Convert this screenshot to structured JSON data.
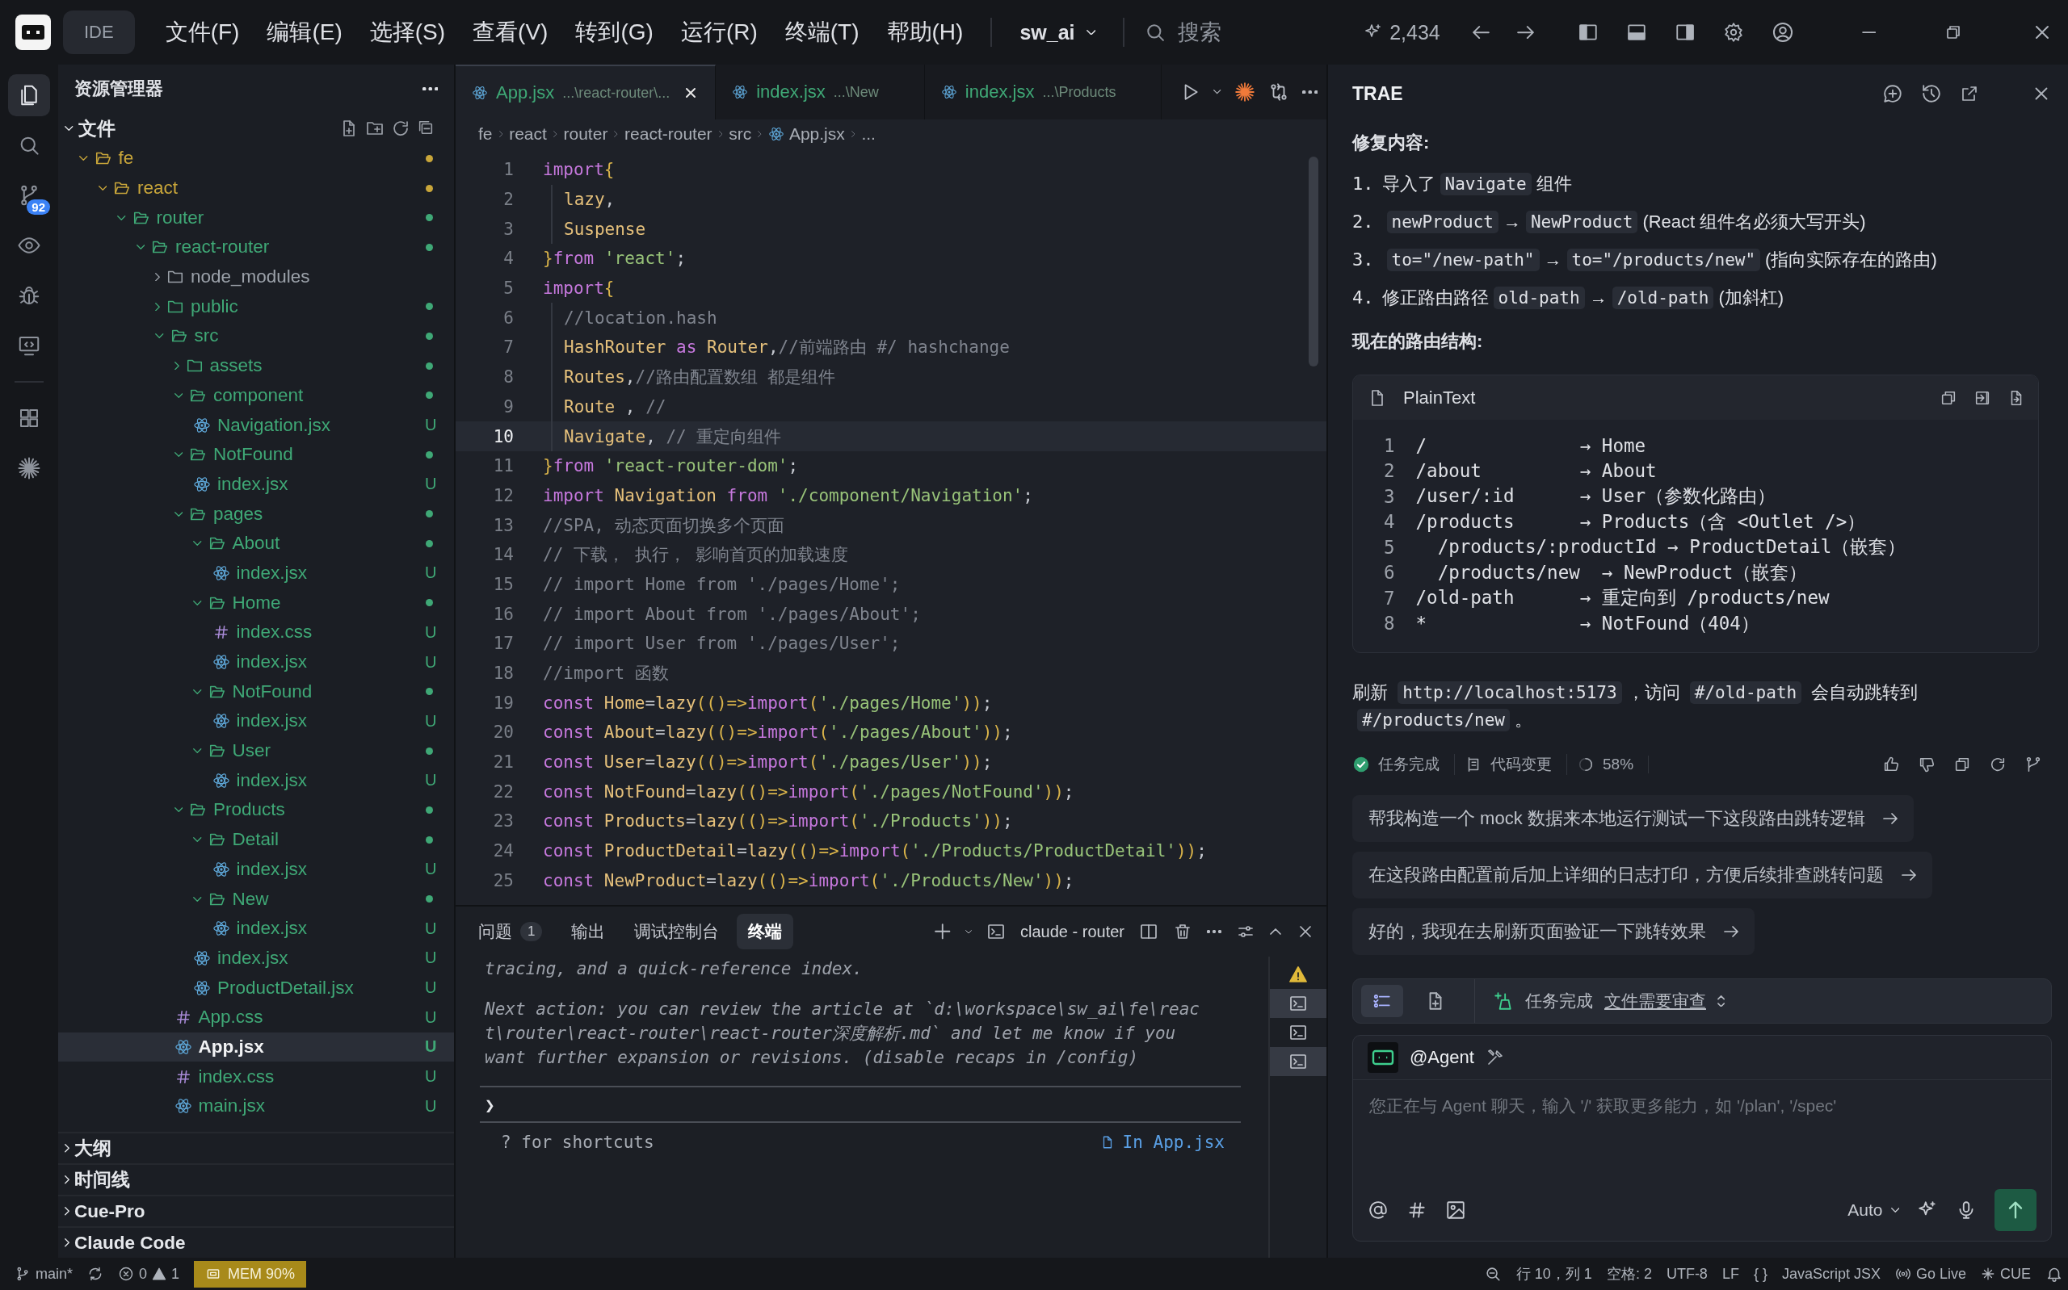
{
  "title_bar": {
    "app_label": "IDE",
    "menus": [
      "文件(F)",
      "编辑(E)",
      "选择(S)",
      "查看(V)",
      "转到(G)",
      "运行(R)",
      "终端(T)",
      "帮助(H)"
    ],
    "project": "sw_ai",
    "search_placeholder": "搜索",
    "credits": "2,434"
  },
  "activity_bar": {
    "items": [
      {
        "kind": "files",
        "selected": true
      },
      {
        "kind": "search",
        "selected": false
      },
      {
        "kind": "source-control",
        "selected": false,
        "badge": "92"
      },
      {
        "kind": "preview",
        "selected": false
      },
      {
        "kind": "debug",
        "selected": false
      },
      {
        "kind": "remote",
        "selected": false
      },
      {
        "kind": "extensions",
        "selected": false
      },
      {
        "kind": "agent",
        "selected": false
      }
    ]
  },
  "explorer": {
    "title": "资源管理器",
    "section": {
      "label": "文件",
      "expanded": true
    },
    "tree": [
      {
        "name": "fe",
        "kind": "folder",
        "expanded": true,
        "selected": false,
        "color": "#c9a63a",
        "dot": true,
        "children": [
          {
            "name": "react",
            "kind": "folder",
            "expanded": true,
            "selected": false,
            "color": "#c9a63a",
            "dot": true,
            "children": [
              {
                "name": "router",
                "kind": "folder",
                "expanded": true,
                "selected": false,
                "color": "#3fa876",
                "dot": true,
                "children": [
                  {
                    "name": "react-router",
                    "kind": "folder",
                    "expanded": true,
                    "selected": false,
                    "color": "#3fa876",
                    "dot": true,
                    "children": [
                      {
                        "name": "node_modules",
                        "kind": "folder",
                        "expanded": false,
                        "selected": false,
                        "color": "#9ba1a9",
                        "dot": false
                      },
                      {
                        "name": "public",
                        "kind": "folder",
                        "expanded": false,
                        "selected": false,
                        "color": "#3fa876",
                        "dot": true
                      },
                      {
                        "name": "src",
                        "kind": "folder",
                        "expanded": true,
                        "selected": false,
                        "color": "#3fa876",
                        "dot": true,
                        "children": [
                          {
                            "name": "assets",
                            "kind": "folder",
                            "expanded": false,
                            "selected": false,
                            "color": "#3fa876",
                            "dot": true
                          },
                          {
                            "name": "component",
                            "kind": "folder",
                            "expanded": true,
                            "selected": false,
                            "color": "#3fa876",
                            "dot": true,
                            "children": [
                              {
                                "name": "Navigation.jsx",
                                "kind": "jsx",
                                "selected": false,
                                "color": "#3fa876",
                                "badge": "U"
                              }
                            ]
                          },
                          {
                            "name": "NotFound",
                            "kind": "folder",
                            "expanded": true,
                            "selected": false,
                            "color": "#3fa876",
                            "dot": true,
                            "children": [
                              {
                                "name": "index.jsx",
                                "kind": "jsx",
                                "selected": false,
                                "color": "#3fa876",
                                "badge": "U"
                              }
                            ]
                          },
                          {
                            "name": "pages",
                            "kind": "folder",
                            "expanded": true,
                            "selected": false,
                            "color": "#3fa876",
                            "dot": true,
                            "children": [
                              {
                                "name": "About",
                                "kind": "folder",
                                "expanded": true,
                                "selected": false,
                                "color": "#3fa876",
                                "dot": true,
                                "children": [
                                  {
                                    "name": "index.jsx",
                                    "kind": "jsx",
                                    "selected": false,
                                    "color": "#3fa876",
                                    "badge": "U"
                                  }
                                ]
                              },
                              {
                                "name": "Home",
                                "kind": "folder",
                                "expanded": true,
                                "selected": false,
                                "color": "#3fa876",
                                "dot": true,
                                "children": [
                                  {
                                    "name": "index.css",
                                    "kind": "css",
                                    "selected": false,
                                    "color": "#3fa876",
                                    "badge": "U"
                                  },
                                  {
                                    "name": "index.jsx",
                                    "kind": "jsx",
                                    "selected": false,
                                    "color": "#3fa876",
                                    "badge": "U"
                                  }
                                ]
                              },
                              {
                                "name": "NotFound",
                                "kind": "folder",
                                "expanded": true,
                                "selected": false,
                                "color": "#3fa876",
                                "dot": true,
                                "children": [
                                  {
                                    "name": "index.jsx",
                                    "kind": "jsx",
                                    "selected": false,
                                    "color": "#3fa876",
                                    "badge": "U"
                                  }
                                ]
                              },
                              {
                                "name": "User",
                                "kind": "folder",
                                "expanded": true,
                                "selected": false,
                                "color": "#3fa876",
                                "dot": true,
                                "children": [
                                  {
                                    "name": "index.jsx",
                                    "kind": "jsx",
                                    "selected": false,
                                    "color": "#3fa876",
                                    "badge": "U"
                                  }
                                ]
                              }
                            ]
                          },
                          {
                            "name": "Products",
                            "kind": "folder",
                            "expanded": true,
                            "selected": false,
                            "color": "#3fa876",
                            "dot": true,
                            "children": [
                              {
                                "name": "Detail",
                                "kind": "folder",
                                "expanded": true,
                                "selected": false,
                                "color": "#3fa876",
                                "dot": true,
                                "children": [
                                  {
                                    "name": "index.jsx",
                                    "kind": "jsx",
                                    "selected": false,
                                    "color": "#3fa876",
                                    "badge": "U"
                                  }
                                ]
                              },
                              {
                                "name": "New",
                                "kind": "folder",
                                "expanded": true,
                                "selected": false,
                                "color": "#3fa876",
                                "dot": true,
                                "children": [
                                  {
                                    "name": "index.jsx",
                                    "kind": "jsx",
                                    "selected": false,
                                    "color": "#3fa876",
                                    "badge": "U"
                                  }
                                ]
                              },
                              {
                                "name": "index.jsx",
                                "kind": "jsx",
                                "selected": false,
                                "color": "#3fa876",
                                "badge": "U"
                              },
                              {
                                "name": "ProductDetail.jsx",
                                "kind": "jsx",
                                "selected": false,
                                "color": "#3fa876",
                                "badge": "U"
                              }
                            ]
                          },
                          {
                            "name": "App.css",
                            "kind": "css",
                            "selected": false,
                            "color": "#3fa876",
                            "badge": "U"
                          },
                          {
                            "name": "App.jsx",
                            "kind": "jsx",
                            "selected": true,
                            "color": "#3fa876",
                            "badge": "U"
                          },
                          {
                            "name": "index.css",
                            "kind": "css",
                            "selected": false,
                            "color": "#3fa876",
                            "badge": "U"
                          },
                          {
                            "name": "main.jsx",
                            "kind": "jsx",
                            "selected": false,
                            "color": "#3fa876",
                            "badge": "U"
                          }
                        ]
                      }
                    ]
                  }
                ]
              }
            ]
          }
        ]
      }
    ],
    "panels": [
      {
        "label": "大纲",
        "expanded": false
      },
      {
        "label": "时间线",
        "expanded": false
      },
      {
        "label": "Cue-Pro",
        "expanded": false
      },
      {
        "label": "Claude Code",
        "expanded": false
      }
    ]
  },
  "editor": {
    "tabs": [
      {
        "name": "App.jsx",
        "path": "...\\react-router\\...",
        "selected": true
      },
      {
        "name": "index.jsx",
        "path": "...\\New",
        "selected": false
      },
      {
        "name": "index.jsx",
        "path": "...\\Products",
        "selected": false
      }
    ],
    "breadcrumbs": [
      {
        "label": "fe",
        "kind": "folder"
      },
      {
        "label": "react",
        "kind": "folder"
      },
      {
        "label": "router",
        "kind": "folder"
      },
      {
        "label": "react-router",
        "kind": "folder"
      },
      {
        "label": "src",
        "kind": "folder"
      },
      {
        "label": "App.jsx",
        "kind": "jsx"
      },
      {
        "label": "...",
        "kind": "more"
      }
    ],
    "lines": [
      {
        "number": "1",
        "selected": false,
        "indent": false,
        "tokens": [
          {
            "kind": "kw",
            "text": "import"
          },
          {
            "kind": "br",
            "text": "{"
          }
        ]
      },
      {
        "number": "2",
        "selected": false,
        "indent": true,
        "tokens": [
          {
            "kind": "id",
            "text": "lazy"
          },
          {
            "kind": "p",
            "text": ","
          }
        ]
      },
      {
        "number": "3",
        "selected": false,
        "indent": true,
        "tokens": [
          {
            "kind": "id",
            "text": "Suspense"
          }
        ]
      },
      {
        "number": "4",
        "selected": false,
        "indent": false,
        "tokens": [
          {
            "kind": "br",
            "text": "}"
          },
          {
            "kind": "kw",
            "text": "from "
          },
          {
            "kind": "str",
            "text": "'react'"
          },
          {
            "kind": "p",
            "text": ";"
          }
        ]
      },
      {
        "number": "5",
        "selected": false,
        "indent": false,
        "tokens": [
          {
            "kind": "kw",
            "text": "import"
          },
          {
            "kind": "br",
            "text": "{"
          }
        ]
      },
      {
        "number": "6",
        "selected": false,
        "indent": true,
        "tokens": [
          {
            "kind": "com",
            "text": "//location.hash"
          }
        ]
      },
      {
        "number": "7",
        "selected": false,
        "indent": true,
        "tokens": [
          {
            "kind": "id",
            "text": "HashRouter "
          },
          {
            "kind": "kw",
            "text": "as "
          },
          {
            "kind": "id",
            "text": "Router"
          },
          {
            "kind": "p",
            "text": ","
          },
          {
            "kind": "com",
            "text": "//前端路由 #/ hashchange"
          }
        ]
      },
      {
        "number": "8",
        "selected": false,
        "indent": true,
        "tokens": [
          {
            "kind": "id",
            "text": "Routes"
          },
          {
            "kind": "p",
            "text": ","
          },
          {
            "kind": "com",
            "text": "//路由配置数组 都是组件"
          }
        ]
      },
      {
        "number": "9",
        "selected": false,
        "indent": true,
        "tokens": [
          {
            "kind": "id",
            "text": "Route "
          },
          {
            "kind": "p",
            "text": ", "
          },
          {
            "kind": "com",
            "text": "//"
          }
        ]
      },
      {
        "number": "10",
        "selected": true,
        "indent": true,
        "tokens": [
          {
            "kind": "id",
            "text": "Navigate"
          },
          {
            "kind": "p",
            "text": ", "
          },
          {
            "kind": "com",
            "text": "// 重定向组件"
          }
        ]
      },
      {
        "number": "11",
        "selected": false,
        "indent": false,
        "tokens": [
          {
            "kind": "br",
            "text": "}"
          },
          {
            "kind": "kw",
            "text": "from "
          },
          {
            "kind": "str",
            "text": "'react-router-dom'"
          },
          {
            "kind": "p",
            "text": ";"
          }
        ]
      },
      {
        "number": "12",
        "selected": false,
        "indent": false,
        "tokens": [
          {
            "kind": "kw",
            "text": "import "
          },
          {
            "kind": "id",
            "text": "Navigation "
          },
          {
            "kind": "kw",
            "text": "from "
          },
          {
            "kind": "str",
            "text": "'./component/Navigation'"
          },
          {
            "kind": "p",
            "text": ";"
          }
        ]
      },
      {
        "number": "13",
        "selected": false,
        "indent": false,
        "tokens": [
          {
            "kind": "com",
            "text": "//SPA, 动态页面切换多个页面"
          }
        ]
      },
      {
        "number": "14",
        "selected": false,
        "indent": false,
        "tokens": [
          {
            "kind": "com",
            "text": "// 下载， 执行， 影响首页的加载速度"
          }
        ]
      },
      {
        "number": "15",
        "selected": false,
        "indent": false,
        "tokens": [
          {
            "kind": "com",
            "text": "// import Home from './pages/Home';"
          }
        ]
      },
      {
        "number": "16",
        "selected": false,
        "indent": false,
        "tokens": [
          {
            "kind": "com",
            "text": "// import About from './pages/About';"
          }
        ]
      },
      {
        "number": "17",
        "selected": false,
        "indent": false,
        "tokens": [
          {
            "kind": "com",
            "text": "// import User from './pages/User';"
          }
        ]
      },
      {
        "number": "18",
        "selected": false,
        "indent": false,
        "tokens": [
          {
            "kind": "com",
            "text": "//import 函数"
          }
        ]
      },
      {
        "number": "19",
        "selected": false,
        "indent": false,
        "tokens": [
          {
            "kind": "kw",
            "text": "const "
          },
          {
            "kind": "id",
            "text": "Home"
          },
          {
            "kind": "p",
            "text": "="
          },
          {
            "kind": "id",
            "text": "lazy"
          },
          {
            "kind": "br",
            "text": "(()=>"
          },
          {
            "kind": "kw",
            "text": "import"
          },
          {
            "kind": "br",
            "text": "("
          },
          {
            "kind": "str",
            "text": "'./pages/Home'"
          },
          {
            "kind": "br",
            "text": "))"
          },
          {
            "kind": "p",
            "text": ";"
          }
        ]
      },
      {
        "number": "20",
        "selected": false,
        "indent": false,
        "tokens": [
          {
            "kind": "kw",
            "text": "const "
          },
          {
            "kind": "id",
            "text": "About"
          },
          {
            "kind": "p",
            "text": "="
          },
          {
            "kind": "id",
            "text": "lazy"
          },
          {
            "kind": "br",
            "text": "(()=>"
          },
          {
            "kind": "kw",
            "text": "import"
          },
          {
            "kind": "br",
            "text": "("
          },
          {
            "kind": "str",
            "text": "'./pages/About'"
          },
          {
            "kind": "br",
            "text": "))"
          },
          {
            "kind": "p",
            "text": ";"
          }
        ]
      },
      {
        "number": "21",
        "selected": false,
        "indent": false,
        "tokens": [
          {
            "kind": "kw",
            "text": "const "
          },
          {
            "kind": "id",
            "text": "User"
          },
          {
            "kind": "p",
            "text": "="
          },
          {
            "kind": "id",
            "text": "lazy"
          },
          {
            "kind": "br",
            "text": "(()=>"
          },
          {
            "kind": "kw",
            "text": "import"
          },
          {
            "kind": "br",
            "text": "("
          },
          {
            "kind": "str",
            "text": "'./pages/User'"
          },
          {
            "kind": "br",
            "text": "))"
          },
          {
            "kind": "p",
            "text": ";"
          }
        ]
      },
      {
        "number": "22",
        "selected": false,
        "indent": false,
        "tokens": [
          {
            "kind": "kw",
            "text": "const "
          },
          {
            "kind": "id",
            "text": "NotFound"
          },
          {
            "kind": "p",
            "text": "="
          },
          {
            "kind": "id",
            "text": "lazy"
          },
          {
            "kind": "br",
            "text": "(()=>"
          },
          {
            "kind": "kw",
            "text": "import"
          },
          {
            "kind": "br",
            "text": "("
          },
          {
            "kind": "str",
            "text": "'./pages/NotFound'"
          },
          {
            "kind": "br",
            "text": "))"
          },
          {
            "kind": "p",
            "text": ";"
          }
        ]
      },
      {
        "number": "23",
        "selected": false,
        "indent": false,
        "tokens": [
          {
            "kind": "kw",
            "text": "const "
          },
          {
            "kind": "id",
            "text": "Products"
          },
          {
            "kind": "p",
            "text": "="
          },
          {
            "kind": "id",
            "text": "lazy"
          },
          {
            "kind": "br",
            "text": "(()=>"
          },
          {
            "kind": "kw",
            "text": "import"
          },
          {
            "kind": "br",
            "text": "("
          },
          {
            "kind": "str",
            "text": "'./Products'"
          },
          {
            "kind": "br",
            "text": "))"
          },
          {
            "kind": "p",
            "text": ";"
          }
        ]
      },
      {
        "number": "24",
        "selected": false,
        "indent": false,
        "tokens": [
          {
            "kind": "kw",
            "text": "const "
          },
          {
            "kind": "id",
            "text": "ProductDetail"
          },
          {
            "kind": "p",
            "text": "="
          },
          {
            "kind": "id",
            "text": "lazy"
          },
          {
            "kind": "br",
            "text": "(()=>"
          },
          {
            "kind": "kw",
            "text": "import"
          },
          {
            "kind": "br",
            "text": "("
          },
          {
            "kind": "str",
            "text": "'./Products/ProductDetail'"
          },
          {
            "kind": "br",
            "text": "))"
          },
          {
            "kind": "p",
            "text": ";"
          }
        ]
      },
      {
        "number": "25",
        "selected": false,
        "indent": false,
        "tokens": [
          {
            "kind": "kw",
            "text": "const "
          },
          {
            "kind": "id",
            "text": "NewProduct"
          },
          {
            "kind": "p",
            "text": "="
          },
          {
            "kind": "id",
            "text": "lazy"
          },
          {
            "kind": "br",
            "text": "(()=>"
          },
          {
            "kind": "kw",
            "text": "import"
          },
          {
            "kind": "br",
            "text": "("
          },
          {
            "kind": "str",
            "text": "'./Products/New'"
          },
          {
            "kind": "br",
            "text": "))"
          },
          {
            "kind": "p",
            "text": ";"
          }
        ]
      }
    ]
  },
  "panel": {
    "tabs": [
      {
        "label": "问题",
        "count": "1",
        "selected": false
      },
      {
        "label": "输出",
        "selected": false
      },
      {
        "label": "调试控制台",
        "selected": false
      },
      {
        "label": "终端",
        "selected": true
      }
    ],
    "terminal_name": "claude - router",
    "output": [
      [
        "tracing, and a quick-reference index."
      ],
      [
        "Next action: you can review the article at `d:\\workspace\\sw_ai\\fe\\reac",
        "t\\router\\react-router\\react-router深度解析.md` and let me know if you",
        "want further expansion or revisions. (disable recaps in /config)"
      ]
    ],
    "prompt": "❯",
    "hint": "? for shortcuts",
    "context": "In App.jsx",
    "terminals": [
      {
        "kind": "warning",
        "selected": false
      },
      {
        "kind": "terminal",
        "selected": true
      },
      {
        "kind": "terminal",
        "selected": false
      },
      {
        "kind": "terminal",
        "selected": true
      }
    ]
  },
  "assistant": {
    "title": "TRAE",
    "heading": "修复内容:",
    "fixes": [
      {
        "number": "1.",
        "parts": [
          {
            "kind": "text",
            "text": "导入了"
          },
          {
            "kind": "code",
            "text": "Navigate"
          },
          {
            "kind": "text",
            "text": "组件"
          }
        ]
      },
      {
        "number": "2.",
        "parts": [
          {
            "kind": "code",
            "text": "newProduct"
          },
          {
            "kind": "text",
            "text": "→"
          },
          {
            "kind": "code",
            "text": "NewProduct"
          },
          {
            "kind": "text",
            "text": "(React 组件名必须大写开头)"
          }
        ]
      },
      {
        "number": "3.",
        "parts": [
          {
            "kind": "code",
            "text": "to=\"/new-path\""
          },
          {
            "kind": "text",
            "text": "→"
          },
          {
            "kind": "code",
            "text": "to=\"/products/new\""
          },
          {
            "kind": "text",
            "text": "(指向实际存在的路由)"
          }
        ]
      },
      {
        "number": "4.",
        "parts": [
          {
            "kind": "text",
            "text": "修正路由路径"
          },
          {
            "kind": "code",
            "text": "old-path"
          },
          {
            "kind": "text",
            "text": "→"
          },
          {
            "kind": "code",
            "text": "/old-path"
          },
          {
            "kind": "text",
            "text": "(加斜杠)"
          }
        ]
      }
    ],
    "routes_heading": "现在的路由结构:",
    "code_block": {
      "language": "PlainText",
      "lines": [
        {
          "number": "1",
          "text": "/              → Home"
        },
        {
          "number": "2",
          "text": "/about         → About"
        },
        {
          "number": "3",
          "text": "/user/:id      → User（参数化路由）"
        },
        {
          "number": "4",
          "text": "/products      → Products（含 <Outlet />）"
        },
        {
          "number": "5",
          "text": "  /products/:productId → ProductDetail（嵌套）"
        },
        {
          "number": "6",
          "text": "  /products/new  → NewProduct（嵌套）"
        },
        {
          "number": "7",
          "text": "/old-path      → 重定向到 /products/new"
        },
        {
          "number": "8",
          "text": "*              → NotFound（404）"
        }
      ]
    },
    "summary": [
      {
        "kind": "text",
        "text": "刷新 "
      },
      {
        "kind": "code",
        "text": "http://localhost:5173"
      },
      {
        "kind": "text",
        "text": "，访问 "
      },
      {
        "kind": "code",
        "text": "#/old-path"
      },
      {
        "kind": "text",
        "text": " 会自动跳转到 "
      },
      {
        "kind": "code",
        "text": "#/products/new"
      },
      {
        "kind": "text",
        "text": "。"
      }
    ],
    "task_status": "任务完成",
    "changes": "代码变更",
    "progress": "58%",
    "suggestions": [
      "帮我构造一个 mock 数据来本地运行测试一下这段路由跳转逻辑",
      "在这段路由配置前后加上详细的日志打印，方便后续排查跳转问题",
      "好的，我现在去刷新页面验证一下跳转效果"
    ],
    "composer": {
      "views": [
        {
          "kind": "list",
          "selected": true
        },
        {
          "kind": "doc",
          "selected": false
        }
      ],
      "status": "任务完成",
      "review_link": "文件需要审查",
      "agent": "@Agent",
      "placeholder": "您正在与 Agent 聊天，输入 '/' 获取更多能力，如 '/plan', '/spec'",
      "model": "Auto"
    }
  },
  "status_bar": {
    "branch": "main*",
    "errors": "0",
    "warnings": "1",
    "memory": "MEM 90%",
    "position": "行 10，列 1",
    "indent": "空格: 2",
    "encoding": "UTF-8",
    "eol": "LF",
    "braces": "{ }",
    "language": "JavaScript JSX",
    "live": "Go Live",
    "cue": "CUE"
  }
}
